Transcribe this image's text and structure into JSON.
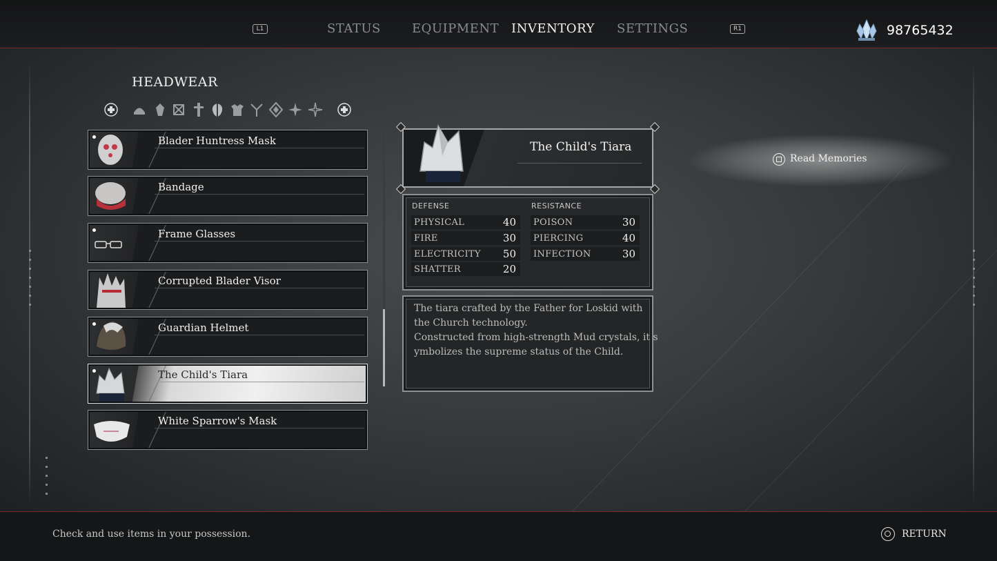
{
  "nav": {
    "left_shoulder": "L1",
    "right_shoulder": "R1",
    "tabs": [
      {
        "label": "STATUS",
        "active": false
      },
      {
        "label": "EQUIPMENT",
        "active": false
      },
      {
        "label": "INVENTORY",
        "active": true
      },
      {
        "label": "SETTINGS",
        "active": false
      }
    ],
    "currency_icon": "crystal-icon",
    "currency_amount": "98765432"
  },
  "category": {
    "title": "HEADWEAR",
    "filter_icons": [
      "lb-button-icon",
      "helmet-icon",
      "gem-icon",
      "crossed-icon",
      "cross-icon",
      "mask-icon",
      "armor-icon",
      "fork-icon",
      "diamond-icon",
      "star-icon",
      "sparkle-icon",
      "rb-button-icon"
    ]
  },
  "items": [
    {
      "name": "Blader Huntress Mask",
      "new": true,
      "selected": false
    },
    {
      "name": "Bandage",
      "new": false,
      "selected": false
    },
    {
      "name": "Frame Glasses",
      "new": true,
      "selected": false
    },
    {
      "name": "Corrupted Blader Visor",
      "new": false,
      "selected": false
    },
    {
      "name": "Guardian Helmet",
      "new": true,
      "selected": false
    },
    {
      "name": "The Child's Tiara",
      "new": true,
      "selected": true
    },
    {
      "name": "White Sparrow's Mask",
      "new": false,
      "selected": false
    }
  ],
  "detail": {
    "name": "The Child's Tiara",
    "defense_label": "DEFENSE",
    "resistance_label": "RESISTANCE",
    "defense": [
      {
        "stat": "PHYSICAL",
        "value": "40"
      },
      {
        "stat": "FIRE",
        "value": "30"
      },
      {
        "stat": "ELECTRICITY",
        "value": "50"
      },
      {
        "stat": "SHATTER",
        "value": "20"
      }
    ],
    "resistance": [
      {
        "stat": "POISON",
        "value": "30"
      },
      {
        "stat": "PIERCING",
        "value": "40"
      },
      {
        "stat": "INFECTION",
        "value": "30"
      }
    ],
    "description_lines": [
      "The tiara crafted by the Father for Loskid with",
      "the Church technology.",
      "Constructed from high-strength Mud crystals, it s",
      "ymbolizes the supreme status of the Child."
    ]
  },
  "actions": {
    "read_memories": "Read Memories",
    "return": "RETURN"
  },
  "footer": {
    "hint": "Check and use items in your possession."
  }
}
